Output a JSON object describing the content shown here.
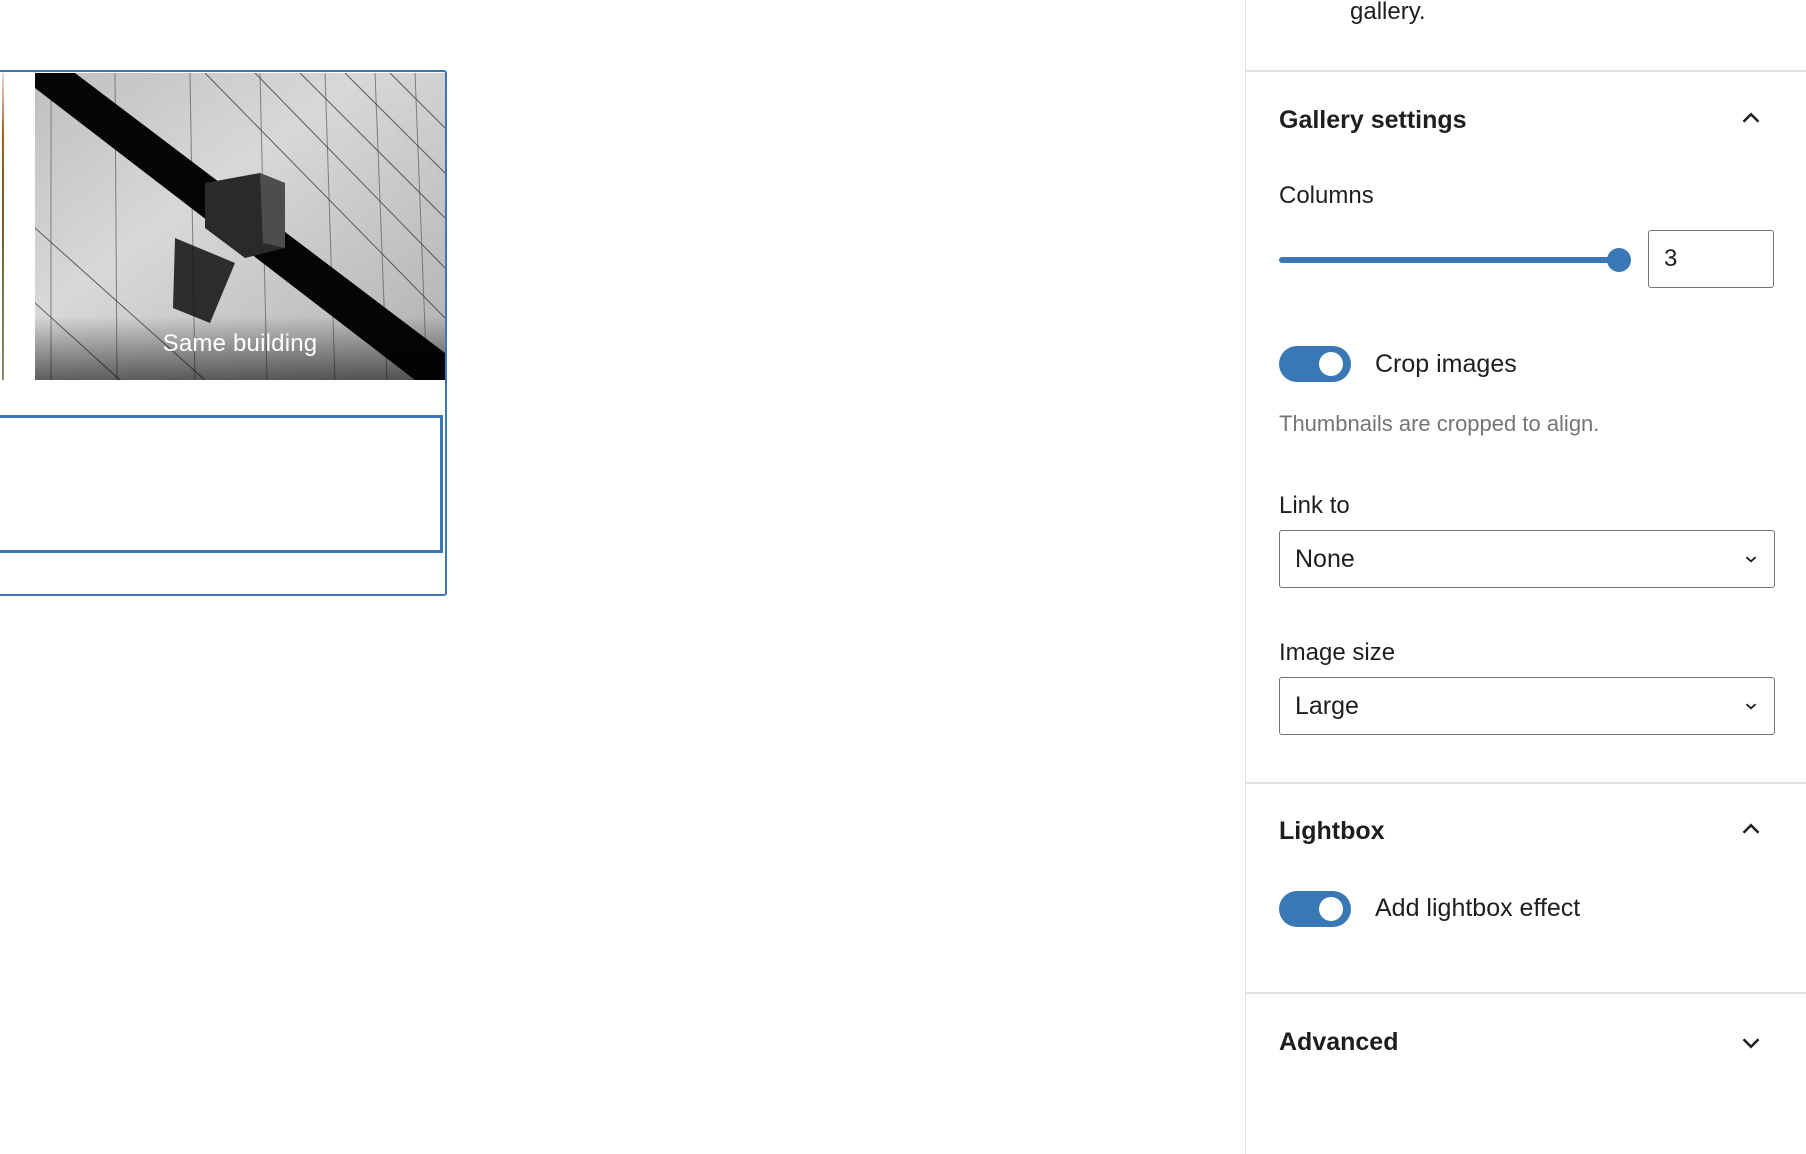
{
  "canvas": {
    "gallery": {
      "images": [
        {
          "caption": "Same building",
          "alt": "Black and white building facade"
        }
      ]
    }
  },
  "sidebar": {
    "intro_tail": "gallery.",
    "gallery_settings": {
      "title": "Gallery settings",
      "expanded": true,
      "columns": {
        "label": "Columns",
        "value": "3",
        "min": 1,
        "max": 3,
        "fill_fraction": 1.0
      },
      "crop_images": {
        "label": "Crop images",
        "enabled": true,
        "help": "Thumbnails are cropped to align."
      },
      "link_to": {
        "label": "Link to",
        "selected": "None"
      },
      "image_size": {
        "label": "Image size",
        "selected": "Large"
      }
    },
    "lightbox": {
      "title": "Lightbox",
      "expanded": true,
      "toggle": {
        "label": "Add lightbox effect",
        "enabled": true
      }
    },
    "advanced": {
      "title": "Advanced",
      "expanded": false
    }
  },
  "colors": {
    "accent": "#3a78b5",
    "border": "#757575",
    "divider": "#e0e0e0",
    "help_text": "#757575",
    "text": "#1e1e1e"
  }
}
